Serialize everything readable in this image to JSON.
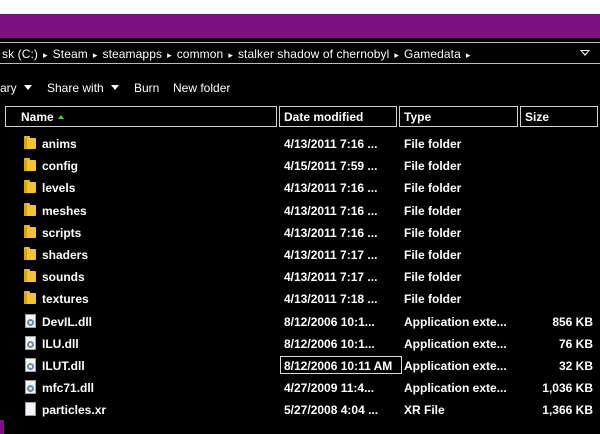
{
  "address": {
    "crumbs": [
      "sk (C:)",
      "Steam",
      "steamapps",
      "common",
      "stalker shadow of chernobyl",
      "Gamedata"
    ],
    "separator": "▸"
  },
  "toolbar": {
    "library_label": "ary",
    "share_label": "Share with",
    "burn_label": "Burn",
    "new_folder_label": "New folder"
  },
  "columns": {
    "name": "Name",
    "date": "Date modified",
    "type": "Type",
    "size": "Size"
  },
  "files": [
    {
      "icon": "folder-icon",
      "name": "anims",
      "date": "4/13/2011 7:16 ...",
      "type": "File folder",
      "size": ""
    },
    {
      "icon": "folder-icon",
      "name": "config",
      "date": "4/15/2011 7:59 ...",
      "type": "File folder",
      "size": ""
    },
    {
      "icon": "folder-icon",
      "name": "levels",
      "date": "4/13/2011 7:16 ...",
      "type": "File folder",
      "size": ""
    },
    {
      "icon": "folder-icon",
      "name": "meshes",
      "date": "4/13/2011 7:16 ...",
      "type": "File folder",
      "size": ""
    },
    {
      "icon": "folder-icon",
      "name": "scripts",
      "date": "4/13/2011 7:16 ...",
      "type": "File folder",
      "size": ""
    },
    {
      "icon": "folder-icon",
      "name": "shaders",
      "date": "4/13/2011 7:17 ...",
      "type": "File folder",
      "size": ""
    },
    {
      "icon": "folder-icon",
      "name": "sounds",
      "date": "4/13/2011 7:17 ...",
      "type": "File folder",
      "size": ""
    },
    {
      "icon": "folder-icon",
      "name": "textures",
      "date": "4/13/2011 7:18 ...",
      "type": "File folder",
      "size": ""
    },
    {
      "icon": "dll-file-icon",
      "name": "DevIL.dll",
      "date": "8/12/2006 10:1...",
      "type": "Application exte...",
      "size": "856 KB"
    },
    {
      "icon": "dll-file-icon",
      "name": "ILU.dll",
      "date": "8/12/2006 10:1...",
      "type": "Application exte...",
      "size": "76 KB"
    },
    {
      "icon": "dll-file-icon",
      "name": "ILUT.dll",
      "date": "8/12/2006 10:11 AM",
      "type": "Application exte...",
      "size": "32 KB"
    },
    {
      "icon": "dll-file-icon",
      "name": "mfc71.dll",
      "date": "4/27/2009 11:4...",
      "type": "Application exte...",
      "size": "1,036 KB"
    },
    {
      "icon": "xr-file-icon",
      "name": "particles.xr",
      "date": "5/27/2008 4:04 ...",
      "type": "XR File",
      "size": "1,366 KB"
    }
  ],
  "colors": {
    "title_band": "#7d1181",
    "background": "#000000",
    "text": "#ffffff",
    "folder": "#f1c435",
    "sort_arrow": "#4ad14a"
  }
}
